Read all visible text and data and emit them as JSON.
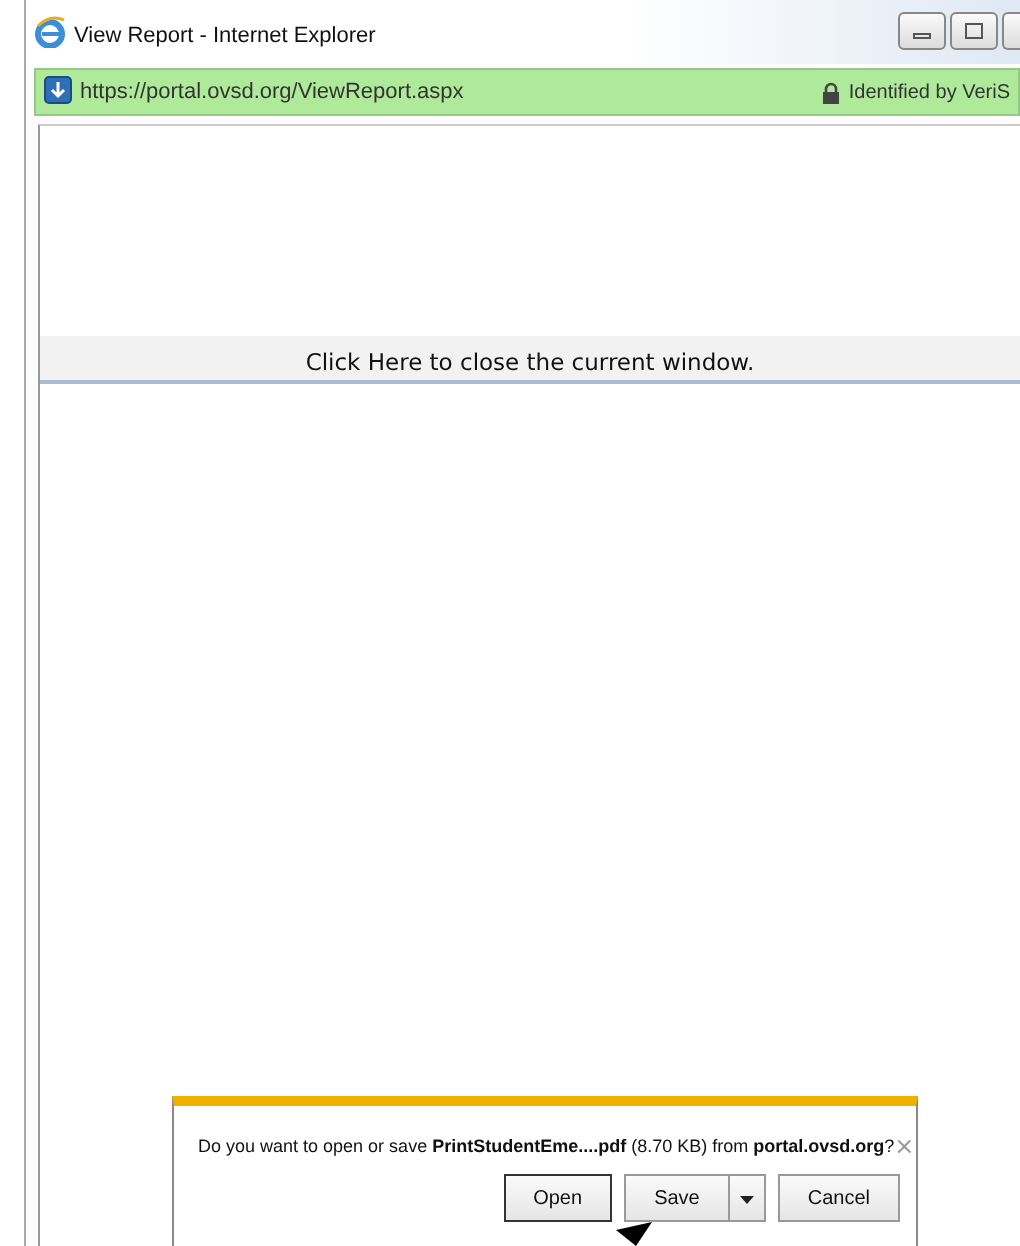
{
  "window": {
    "title": "View Report - Internet Explorer"
  },
  "address_bar": {
    "url": "https://portal.ovsd.org/ViewReport.aspx",
    "identity": "Identified by VeriS"
  },
  "page": {
    "close_link": "Click Here to close the current window."
  },
  "download_bar": {
    "message": "Do you want to open or save **PrintStudentEme....pdf** (8.70 KB) from **portal.ovsd.org**?",
    "close": "×",
    "buttons": [
      {
        "label": "Open",
        "kind": "plain",
        "focused": true
      },
      {
        "label": "Save",
        "kind": "split"
      },
      {
        "label": "Cancel",
        "kind": "plain",
        "focused": false
      }
    ]
  }
}
